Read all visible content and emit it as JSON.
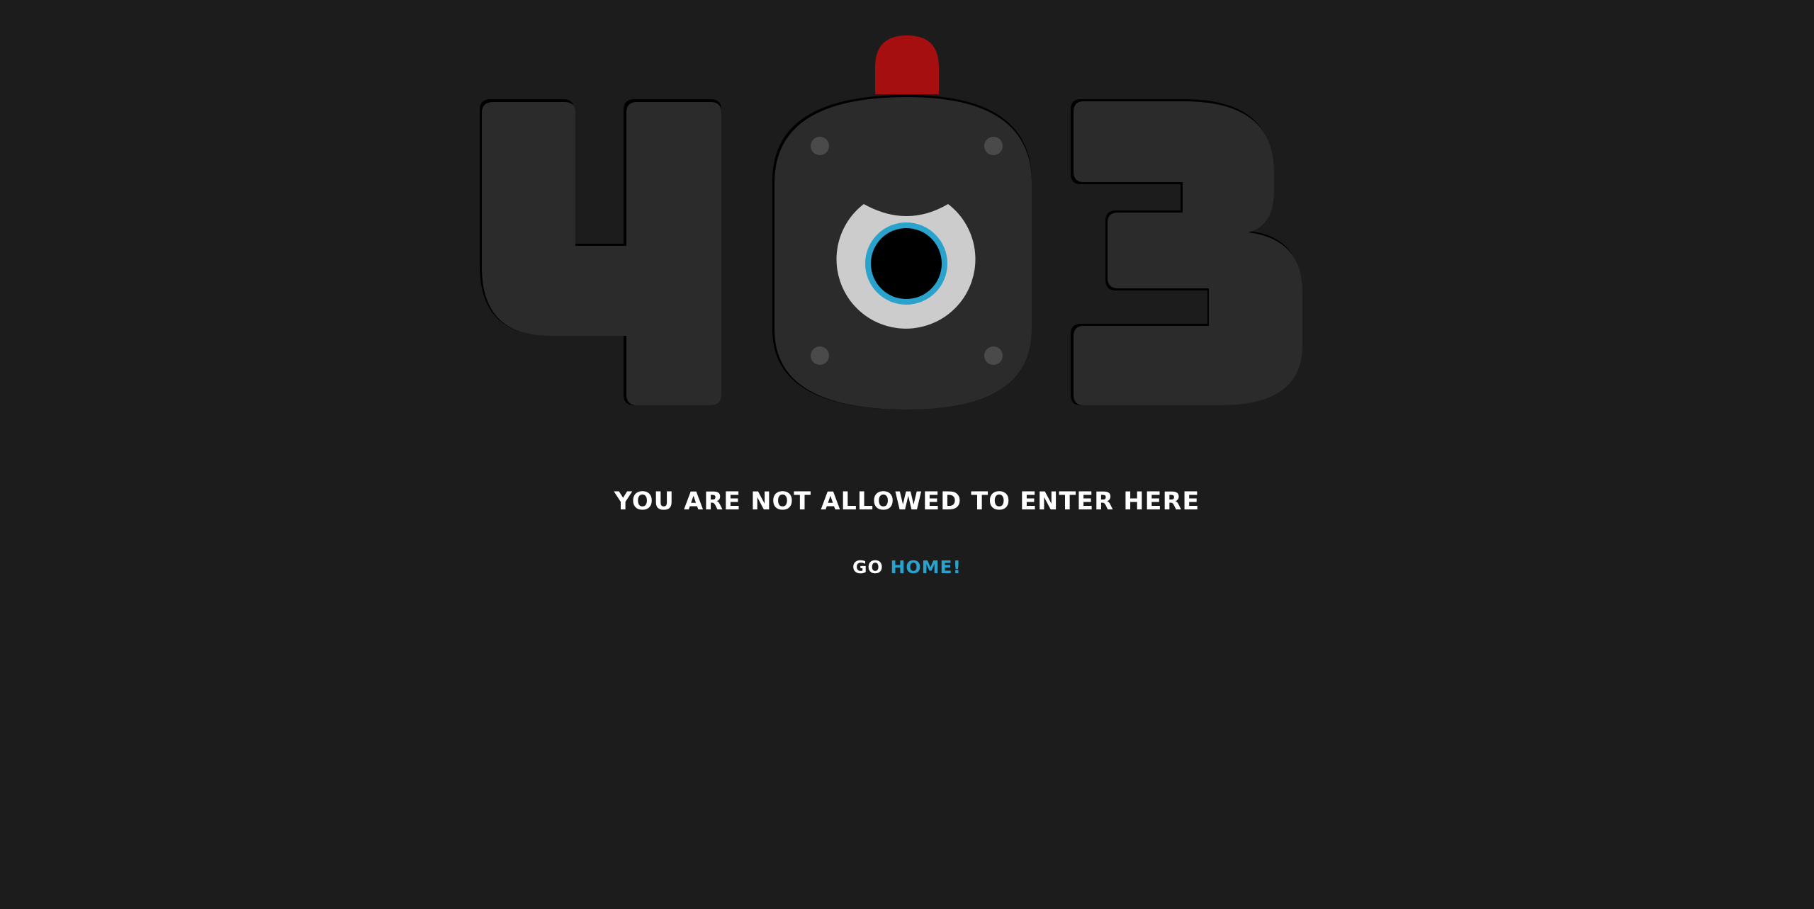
{
  "error": {
    "digit_first": "4",
    "digit_middle": "0",
    "digit_last": "3"
  },
  "message": "YOU ARE NOT ALLOWED TO ENTER HERE",
  "go_home": {
    "prefix": "GO",
    "link_label": "HOME!"
  },
  "icons": {
    "alarm_light": "red-alarm-light-icon",
    "camera_eye": "camera-eye-icon"
  },
  "colors": {
    "background": "#1c1c1c",
    "digit": "#2b2b2b",
    "digit_shadow": "#000000",
    "alarm_red": "#a50f0f",
    "eye_white": "#cccccc",
    "eye_ring": "#2aa3cc",
    "pupil": "#000000",
    "rivet": "#4a4a4a",
    "text": "#ffffff",
    "link": "#2aa3cc"
  }
}
